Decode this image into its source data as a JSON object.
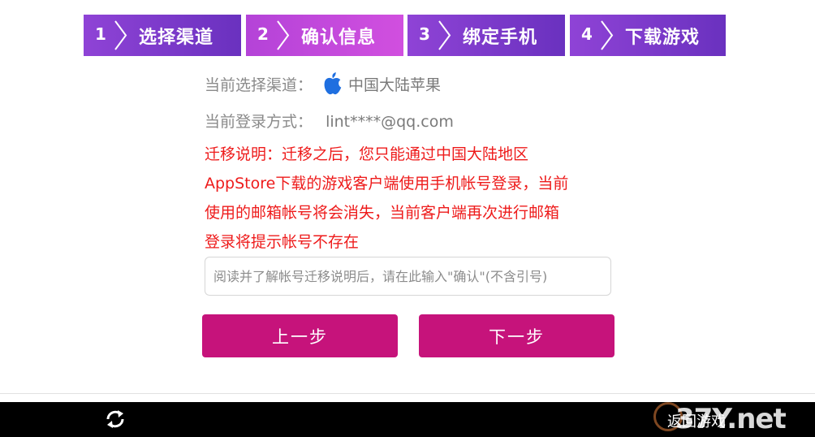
{
  "steps": [
    {
      "num": "1",
      "label": "选择渠道"
    },
    {
      "num": "2",
      "label": "确认信息"
    },
    {
      "num": "3",
      "label": "绑定手机"
    },
    {
      "num": "4",
      "label": "下载游戏"
    }
  ],
  "channel": {
    "label": "当前选择渠道：",
    "value": "中国大陆苹果",
    "icon": "apple-icon"
  },
  "login": {
    "label": "当前登录方式：",
    "value": "lint****@qq.com"
  },
  "notice": {
    "lines": [
      "迁移说明：迁移之后，您只能通过中国大陆地区",
      "AppStore下载的游戏客户端使用手机帐号登录，当前",
      "使用的邮箱帐号将会消失，当前客户端再次进行邮箱",
      "登录将提示帐号不存在"
    ]
  },
  "confirm_input": {
    "value": "",
    "placeholder": "阅读并了解帐号迁移说明后，请在此输入\"确认\"(不含引号)"
  },
  "buttons": {
    "prev": "上一步",
    "next": "下一步"
  },
  "bottom_bar": {
    "refresh_icon": "refresh-icon",
    "back_label": "返回游戏"
  },
  "watermark": {
    "text": "37Y.net"
  },
  "colors": {
    "step_bg": "#6a31bf",
    "step_active_bg": "#c94bdd",
    "notice": "#ee1b1b",
    "button": "#c6137b",
    "bottom_bar": "#000000"
  }
}
